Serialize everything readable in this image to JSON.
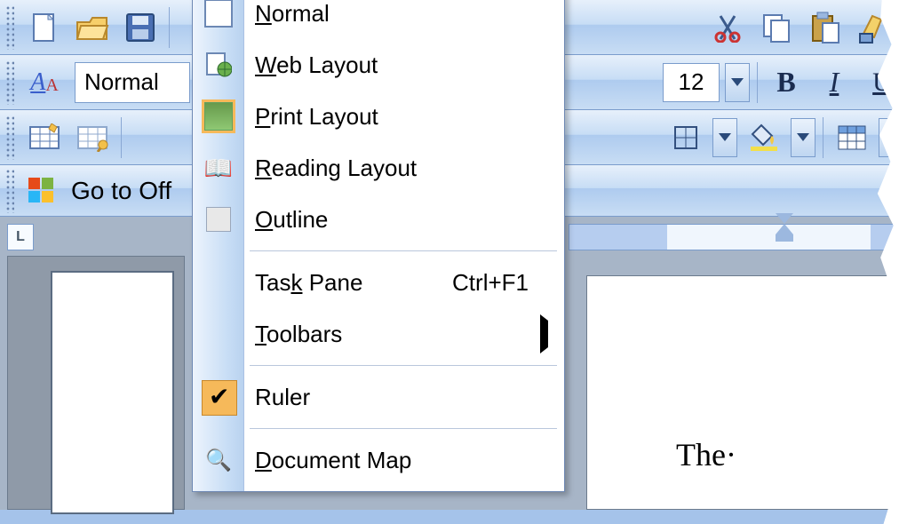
{
  "toolbars": {
    "row1": {
      "new_doc": "new-document-icon",
      "open": "open-folder-icon",
      "save": "save-icon",
      "cut": "cut-icon",
      "copy": "copy-icon",
      "paste": "paste-icon",
      "fmt_painter": "format-painter-icon"
    },
    "row2": {
      "font_style_icon": "font-style-icon",
      "style_name": "Normal",
      "font_size": "12",
      "bold": "B",
      "italic_u": "I",
      "underline": "U"
    },
    "row3": {
      "insert_table": "insert-table-icon",
      "draw_table": "draw-table-icon",
      "border": "border-icon",
      "shading": "shading-icon",
      "table_grid": "table-grid-icon"
    },
    "row4": {
      "office_logo": "office-logo-icon",
      "link_text": "Go to Off"
    }
  },
  "view_menu": {
    "items": [
      {
        "label": "Normal",
        "ukey": "N",
        "icon": "normal-view-icon"
      },
      {
        "label": "Web Layout",
        "ukey": "W",
        "icon": "web-layout-icon"
      },
      {
        "label": "Print Layout",
        "ukey": "P",
        "icon": "print-layout-icon",
        "selected_icon": true
      },
      {
        "label": "Reading Layout",
        "ukey": "R",
        "icon": "reading-layout-icon"
      },
      {
        "label": "Outline",
        "ukey": "O",
        "icon": "outline-view-icon"
      }
    ],
    "items2": [
      {
        "label": "Task Pane",
        "ukey": "k",
        "shortcut": "Ctrl+F1"
      },
      {
        "label": "Toolbars",
        "ukey": "T",
        "submenu": true
      }
    ],
    "items3": [
      {
        "label": "Ruler",
        "checked": true
      }
    ],
    "items4": [
      {
        "label": "Document Map",
        "ukey": "D",
        "icon": "document-map-icon"
      }
    ]
  },
  "ruler": {
    "corner": "L"
  },
  "document": {
    "visible_text": "The·"
  }
}
